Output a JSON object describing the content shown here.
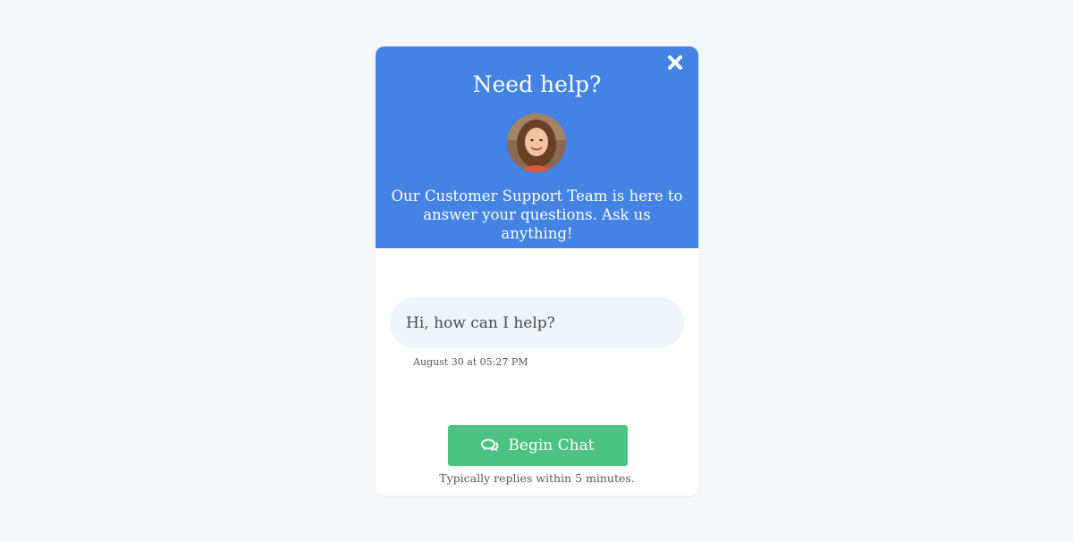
{
  "header": {
    "title": "Need help?",
    "subtitle": "Our Customer Support Team is here to answer your questions. Ask us anything!",
    "close_icon": "close-icon",
    "color": "#4283e4"
  },
  "avatar": {
    "icon": "support-agent-avatar"
  },
  "conversation": {
    "message": "Hi, how can I help?",
    "timestamp": "August 30 at 05:27 PM",
    "bubble_color": "#eef4fa"
  },
  "cta": {
    "label": "Begin Chat",
    "icon": "chat-bubbles-icon",
    "color": "#4dc383",
    "note": "Typically replies within 5 minutes."
  }
}
